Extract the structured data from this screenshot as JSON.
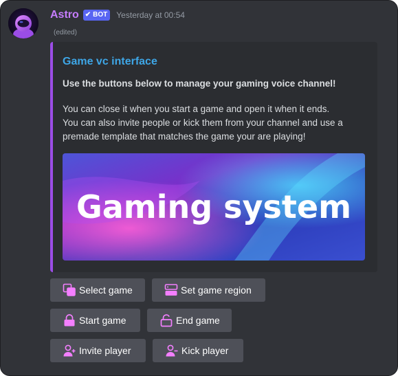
{
  "message": {
    "author": "Astro",
    "bot_tag": "BOT",
    "bot_check": "✔",
    "timestamp": "Yesterday at 00:54",
    "edited": "(edited)"
  },
  "embed": {
    "title": "Game vc interface",
    "subtitle": "Use the buttons below to manage your gaming voice channel!",
    "description_lines": [
      "You can close it when you start a game and open it when it ends.",
      "You can also invite people or kick them from your channel and use a",
      "premade template that matches the game your are playing!"
    ],
    "image_text": "Gaming system"
  },
  "buttons": {
    "select_game": "Select game",
    "set_game_region": "Set game region",
    "start_game": "Start game",
    "end_game": "End game",
    "invite_player": "Invite player",
    "kick_player": "Kick player"
  },
  "colors": {
    "background": "#313338",
    "embed_background": "#2b2d31",
    "embed_accent": "#9b4de6",
    "title_link": "#3ea6e6",
    "username": "#c77dff",
    "bot_tag": "#5865f2",
    "button": "#4e5058",
    "icon_pink": "#f47fff"
  }
}
